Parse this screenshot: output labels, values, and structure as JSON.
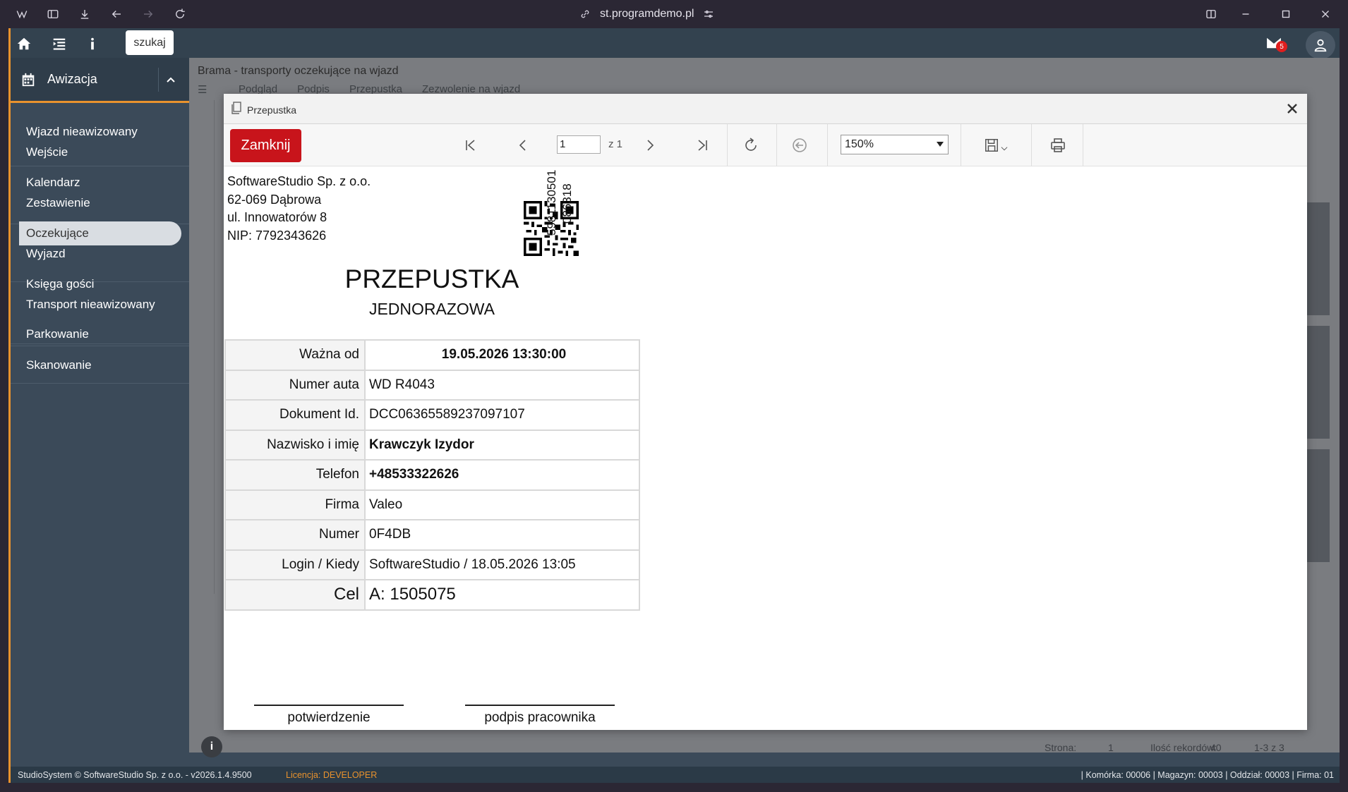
{
  "browser": {
    "url": "st.programdemo.pl"
  },
  "topbar": {
    "search_label": "szukaj",
    "mail_count": "5"
  },
  "sidebar": {
    "header": "Awizacja",
    "groups": [
      [
        "Wjazd nieawizowany",
        "Wejście"
      ],
      [
        "Kalendarz",
        "Zestawienie"
      ],
      [
        "Oczekujące",
        "Wyjazd"
      ],
      [
        "Księga gości",
        "Transport nieawizowany"
      ],
      [
        "Parkowanie"
      ],
      [
        "Skanowanie"
      ]
    ],
    "active": "Oczekujące"
  },
  "content": {
    "breadcrumb": "Brama - transporty oczekujące na wjazd",
    "toolbar": [
      "Podgląd",
      "Podpis",
      "Przepustka",
      "Zezwolenie na wjazd"
    ]
  },
  "pager": {
    "page_label": "Strona:",
    "page_value": "1",
    "records_label": "Ilość rekordów:",
    "records_value": "40",
    "range": "1-3 z 3"
  },
  "status": {
    "left": "StudioSystem © SoftwareStudio Sp. z o.o. - v2026.1.4.9500",
    "license_label": "Licencja:",
    "license_value": "DEVELOPER",
    "right": "| Komórka: 00006 | Magazyn: 00003 | Oddział: 00003 | Firma: 01"
  },
  "modal": {
    "title": "Przepustka",
    "close_button": "Zamknij",
    "page_current": "1",
    "page_of": "z 1",
    "zoom": "150%"
  },
  "document": {
    "company": [
      "SoftwareStudio Sp. z o.o.",
      "62-069 Dąbrowa",
      "ul. Innowatorów 8",
      "NIP: 7792343626"
    ],
    "vertical_code_1": "5981130501",
    "vertical_code_2": "086318",
    "title": "PRZEPUSTKA",
    "subtitle": "JEDNORAZOWA",
    "rows": [
      {
        "label": "Ważna od",
        "value": "19.05.2026 13:30:00"
      },
      {
        "label": "Numer auta",
        "value": "WD R4043"
      },
      {
        "label": "Dokument Id.",
        "value": "DCC06365589237097107"
      },
      {
        "label": "Nazwisko i imię",
        "value": "Krawczyk Izydor"
      },
      {
        "label": "Telefon",
        "value": "+48533322626"
      },
      {
        "label": "Firma",
        "value": "Valeo"
      },
      {
        "label": "Numer",
        "value": "0F4DB"
      },
      {
        "label": "Login / Kiedy",
        "value": "SoftwareStudio / 18.05.2026 13:05"
      },
      {
        "label": "Cel",
        "value": "A: 1505075"
      }
    ],
    "signature_left": "potwierdzenie",
    "signature_right": "podpis pracownika"
  }
}
